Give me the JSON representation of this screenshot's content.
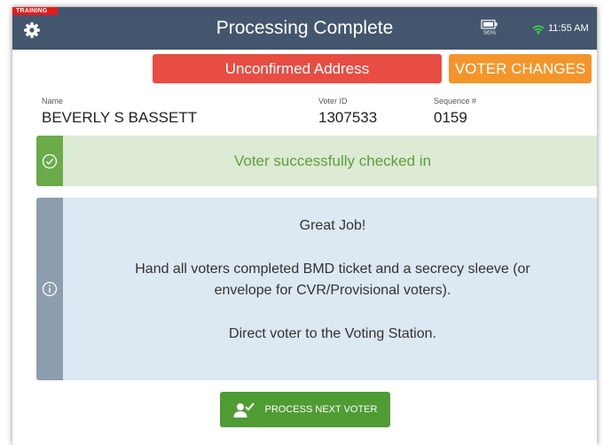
{
  "header": {
    "training_label": "TRAINING",
    "title": "Processing Complete",
    "battery_percent": "96%",
    "time": "11:55 AM",
    "colors": {
      "header_bg": "#43566d",
      "training": "#e31b1b"
    },
    "icons": {
      "settings": "gear-icon",
      "battery": "battery-icon",
      "wifi": "wifi-icon"
    }
  },
  "badges": {
    "address": "Unconfirmed Address",
    "changes": "VOTER CHANGES",
    "colors": {
      "address": "#e84d43",
      "changes": "#f4952b"
    }
  },
  "voter": {
    "name_label": "Name",
    "name": "BEVERLY S BASSETT",
    "id_label": "Voter ID",
    "id": "1307533",
    "sequence_label": "Sequence #",
    "sequence": "0159"
  },
  "success": {
    "message": "Voter successfully checked in",
    "icon": "check-circle-icon",
    "color": "#6bab4a"
  },
  "info": {
    "icon": "info-circle-icon",
    "line1": "Great Job!",
    "line2": "Hand all voters completed BMD ticket and a secrecy sleeve (or",
    "line3": "envelope for CVR/Provisional voters).",
    "line4": "Direct voter to the Voting Station."
  },
  "action": {
    "label": "PROCESS NEXT VOTER",
    "icon": "user-check-icon",
    "color": "#4f9b34"
  }
}
